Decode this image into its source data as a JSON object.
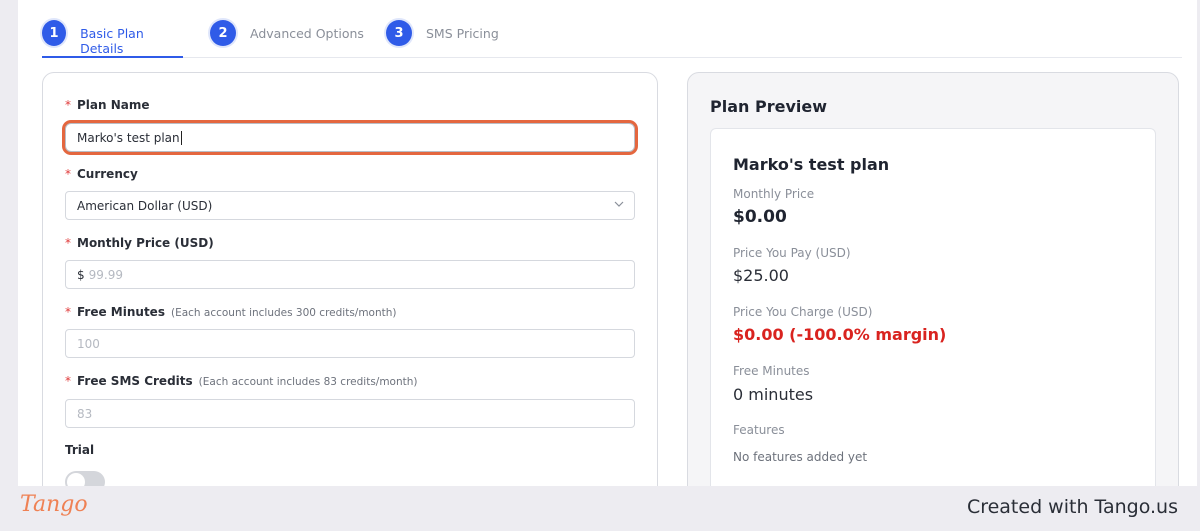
{
  "stepper": {
    "steps": [
      {
        "num": "1",
        "label": "Basic Plan Details"
      },
      {
        "num": "2",
        "label": "Advanced Options"
      },
      {
        "num": "3",
        "label": "SMS Pricing"
      }
    ]
  },
  "form": {
    "plan_name": {
      "label": "Plan Name",
      "value": "Marko's test plan"
    },
    "currency": {
      "label": "Currency",
      "value": "American Dollar (USD)"
    },
    "monthly_price": {
      "label": "Monthly Price (USD)",
      "prefix": "$",
      "placeholder": "99.99"
    },
    "free_minutes": {
      "label": "Free Minutes",
      "hint": "(Each account includes 300 credits/month)",
      "placeholder": "100"
    },
    "free_sms": {
      "label": "Free SMS Credits",
      "hint": "(Each account includes 83 credits/month)",
      "placeholder": "83"
    },
    "trial": {
      "label": "Trial"
    },
    "required_mark": "*"
  },
  "preview": {
    "title": "Plan Preview",
    "plan_name": "Marko's test plan",
    "monthly_price_label": "Monthly Price",
    "monthly_price_value": "$0.00",
    "price_you_pay_label": "Price You Pay (USD)",
    "price_you_pay_value": "$25.00",
    "price_you_charge_label": "Price You Charge (USD)",
    "price_you_charge_value": "$0.00 (-100.0% margin)",
    "free_minutes_label": "Free Minutes",
    "free_minutes_value": "0 minutes",
    "features_label": "Features",
    "features_value": "No features added yet"
  },
  "footer": {
    "logo": "Tango",
    "created": "Created with Tango.us"
  },
  "colors": {
    "accent": "#2f5be8",
    "focus_ring": "#e4673f",
    "danger": "#d9231f",
    "tango": "#ef8154"
  }
}
